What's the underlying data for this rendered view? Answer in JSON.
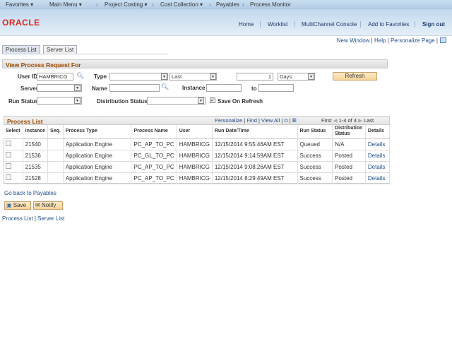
{
  "topnav": {
    "favorites": "Favorites ▾",
    "main_menu": "Main Menu ▾",
    "breadcrumbs": [
      "Project Costing ▾",
      "Cost Collection ▾",
      "Payables",
      "Process Monitor"
    ]
  },
  "header": {
    "logo": "ORACLE",
    "links": [
      "Home",
      "Worklist",
      "MultiChannel Console",
      "Add to Favorites",
      "Sign out"
    ]
  },
  "pagebar": {
    "new_window": "New Window",
    "help": "Help",
    "personalize": "Personalize Page"
  },
  "tabs": [
    {
      "label": "Process List",
      "active": true
    },
    {
      "label": "Server List",
      "active": false
    }
  ],
  "filter": {
    "title": "View Process Request For",
    "user_id_label": "User ID",
    "user_id": "HAMBRICG",
    "type_label": "Type",
    "type_value": "",
    "last_value": "Last",
    "count": "1",
    "unit": "Days",
    "refresh": "Refresh",
    "server_label": "Server",
    "name_label": "Name",
    "instance_label": "Instance",
    "to_label": "to",
    "run_status_label": "Run Status",
    "dist_status_label": "Distribution Status",
    "save_on_refresh": "Save On Refresh",
    "save_on_refresh_checked": true
  },
  "grid": {
    "title": "Process List",
    "personalize": "Personalize",
    "find": "Find",
    "view_all": "View All",
    "first": "First",
    "range": "1-4 of 4",
    "last": "Last",
    "columns": [
      "Select",
      "Instance",
      "Seq.",
      "Process Type",
      "Process Name",
      "User",
      "Run Date/Time",
      "Run Status",
      "Distribution Status",
      "Details"
    ],
    "rows": [
      {
        "instance": "21540",
        "seq": "",
        "type": "Application Engine",
        "name": "PC_AP_TO_PC",
        "user": "HAMBRICG",
        "date": "12/15/2014  9:55:46AM EST",
        "status": "Queued",
        "dist": "N/A",
        "details": "Details"
      },
      {
        "instance": "21536",
        "seq": "",
        "type": "Application Engine",
        "name": "PC_GL_TO_PC",
        "user": "HAMBRICG",
        "date": "12/15/2014  9:14:59AM EST",
        "status": "Success",
        "dist": "Posted",
        "details": "Details"
      },
      {
        "instance": "21535",
        "seq": "",
        "type": "Application Engine",
        "name": "PC_AP_TO_PC",
        "user": "HAMBRICG",
        "date": "12/15/2014  9:08:26AM EST",
        "status": "Success",
        "dist": "Posted",
        "details": "Details"
      },
      {
        "instance": "21528",
        "seq": "",
        "type": "Application Engine",
        "name": "PC_AP_TO_PC",
        "user": "HAMBRICG",
        "date": "12/15/2014  8:29:49AM EST",
        "status": "Success",
        "dist": "Posted",
        "details": "Details"
      }
    ]
  },
  "footer": {
    "go_back": "Go back to Payables",
    "save": "Save",
    "notify": "Notify",
    "process_list": "Process List",
    "server_list": "Server List",
    "sep": "|"
  },
  "colors": {
    "accent": "#9c4a00",
    "logo": "#e2231a",
    "link": "#1f4e8c"
  }
}
